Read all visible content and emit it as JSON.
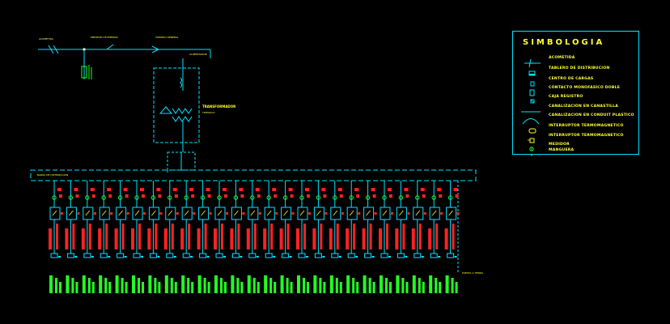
{
  "diagram": {
    "top_labels": [
      "ACOMETIDA",
      "MEDIDOR DE ENERGIA",
      "TABLERO GENERAL"
    ],
    "transformer_label": "TRANSFORMADOR",
    "transformer_sub": "TRIFASICO",
    "feeder_label": "ALIMENTADOR",
    "bus_label": "BARRA DE DISTRIBUCION",
    "ground_label": "PUESTA A TIERRA",
    "circuit_count": 25
  },
  "legend": {
    "title": "SIMBOLOGIA",
    "items": [
      {
        "label": "ACOMETIDA",
        "icon": "acometida-icon"
      },
      {
        "label": "TABLERO DE DISTRIBUCION",
        "icon": "panel-icon"
      },
      {
        "label": "CENTRO DE CARGAS",
        "icon": "load-center-icon"
      },
      {
        "label": "CONTACTO MONOFASICO DOBLE",
        "icon": "outlet-icon"
      },
      {
        "label": "CAJA REGISTRO",
        "icon": "junction-box-icon"
      },
      {
        "label": "CANALIZACION EN CANASTILLA",
        "icon": "tray-line-icon"
      },
      {
        "label": "CANALIZACION EN CONDUIT PLASTICO",
        "icon": "conduit-arc-icon"
      },
      {
        "label": "INTERRUPTOR TERMOMAGNETICO",
        "icon": "breaker-icon"
      },
      {
        "label": "INTERRUPTOR TERMOMAGNETICO",
        "icon": "breaker-small-icon"
      },
      {
        "label": "MEDIDOR",
        "icon": "meter-icon"
      },
      {
        "label": "MANGUERA",
        "icon": "hose-icon"
      }
    ]
  },
  "colors": {
    "background": "#000000",
    "line": "#00e5ff",
    "label": "#ffff33",
    "circuit_red": "#ff2222",
    "circuit_green": "#22ff22",
    "white": "#ffffff"
  }
}
